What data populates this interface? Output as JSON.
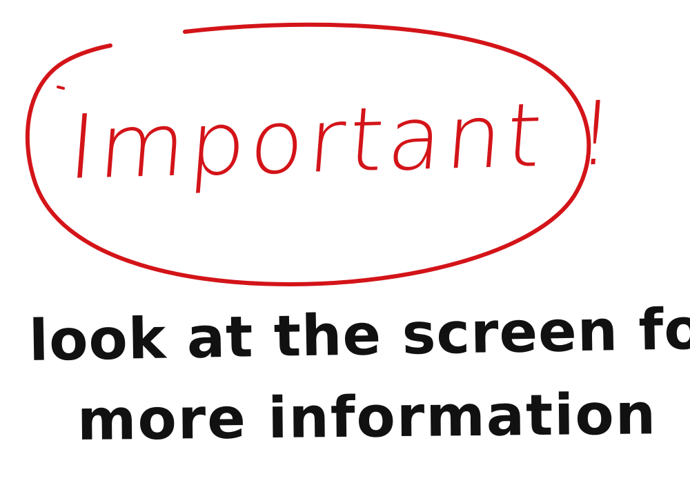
{
  "colors": {
    "background": "#ffffff",
    "marker_red": "#d31419",
    "marker_black": "#111111"
  },
  "note": {
    "headline": "Important !",
    "line1": "look at the screen for",
    "line2": "more information"
  }
}
